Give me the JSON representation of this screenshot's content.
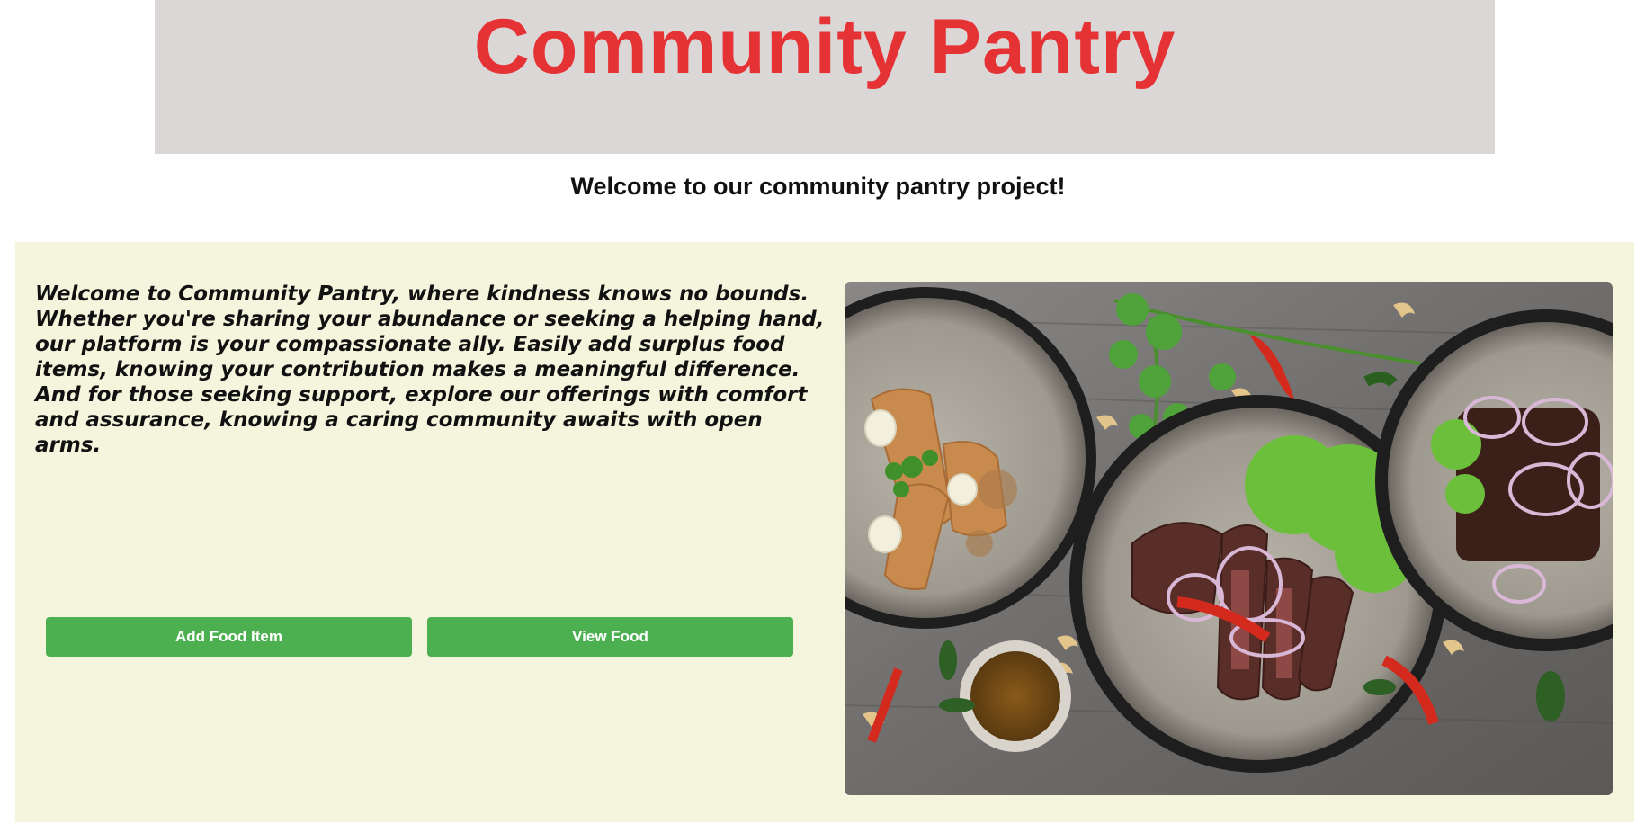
{
  "header": {
    "title": "Community Pantry"
  },
  "subtitle": "Welcome to our community pantry project!",
  "intro": {
    "text": "Welcome to Community Pantry, where kindness knows no bounds. Whether you're sharing your abundance or seeking a helping hand, our platform is your compassionate ally. Easily add surplus food items, knowing your contribution makes a meaningful difference. And for those seeking support, explore our offerings with comfort and assurance, knowing a caring community awaits with open arms."
  },
  "actions": {
    "add_label": "Add Food Item",
    "view_label": "View Food"
  },
  "colors": {
    "title_red": "#e53235",
    "header_bg": "#dcd7d7",
    "panel_bg": "#f4f5dc",
    "button_green": "#4caf50",
    "button_text": "#ffffff"
  }
}
